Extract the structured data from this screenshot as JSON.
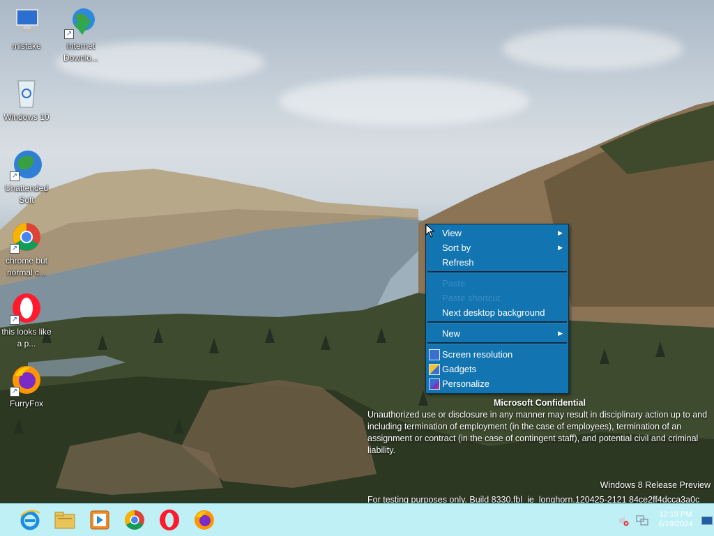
{
  "desktop": {
    "icons": [
      {
        "label": "mistake"
      },
      {
        "label": "Internet Downlo..."
      },
      {
        "label": "Windows 10"
      },
      {
        "label": "Unattended Soft"
      },
      {
        "label": "chrome but normal c..."
      },
      {
        "label": "this looks like a p..."
      },
      {
        "label": "FurryFox"
      }
    ]
  },
  "context_menu": {
    "items": [
      {
        "label": "View",
        "has_submenu": true,
        "disabled": false
      },
      {
        "label": "Sort by",
        "has_submenu": true,
        "disabled": false
      },
      {
        "label": "Refresh",
        "disabled": false
      },
      {
        "label": "Paste",
        "disabled": true
      },
      {
        "label": "Paste shortcut",
        "disabled": true
      },
      {
        "label": "Next desktop background",
        "disabled": false
      },
      {
        "label": "New",
        "has_submenu": true,
        "disabled": false
      },
      {
        "label": "Screen resolution",
        "icon": "display-icon",
        "disabled": false
      },
      {
        "label": "Gadgets",
        "icon": "gadgets-icon",
        "disabled": false
      },
      {
        "label": "Personalize",
        "icon": "personalize-icon",
        "disabled": false
      }
    ]
  },
  "watermark": {
    "title": "Microsoft Confidential",
    "body": "Unauthorized use or disclosure in any manner may result in disciplinary action up to and including termination of employment (in the case of employees), termination of an assignment or contract (in the case of contingent staff), and potential civil and criminal liability.",
    "version": "Windows 8 Release Preview",
    "build": "For testing purposes only. Build 8330.fbl_ie_longhorn.120425-2121 84ce2ff4dcca3a0c"
  },
  "taskbar": {
    "pinned": [
      "internet-explorer-icon",
      "file-explorer-icon",
      "media-player-icon",
      "chrome-icon",
      "opera-icon",
      "firefox-icon"
    ],
    "clock_time": "12:19 PM",
    "clock_date": "6/19/2024"
  },
  "colors": {
    "menu_bg": "#1274b0",
    "taskbar_bg": "#bff0f5"
  }
}
